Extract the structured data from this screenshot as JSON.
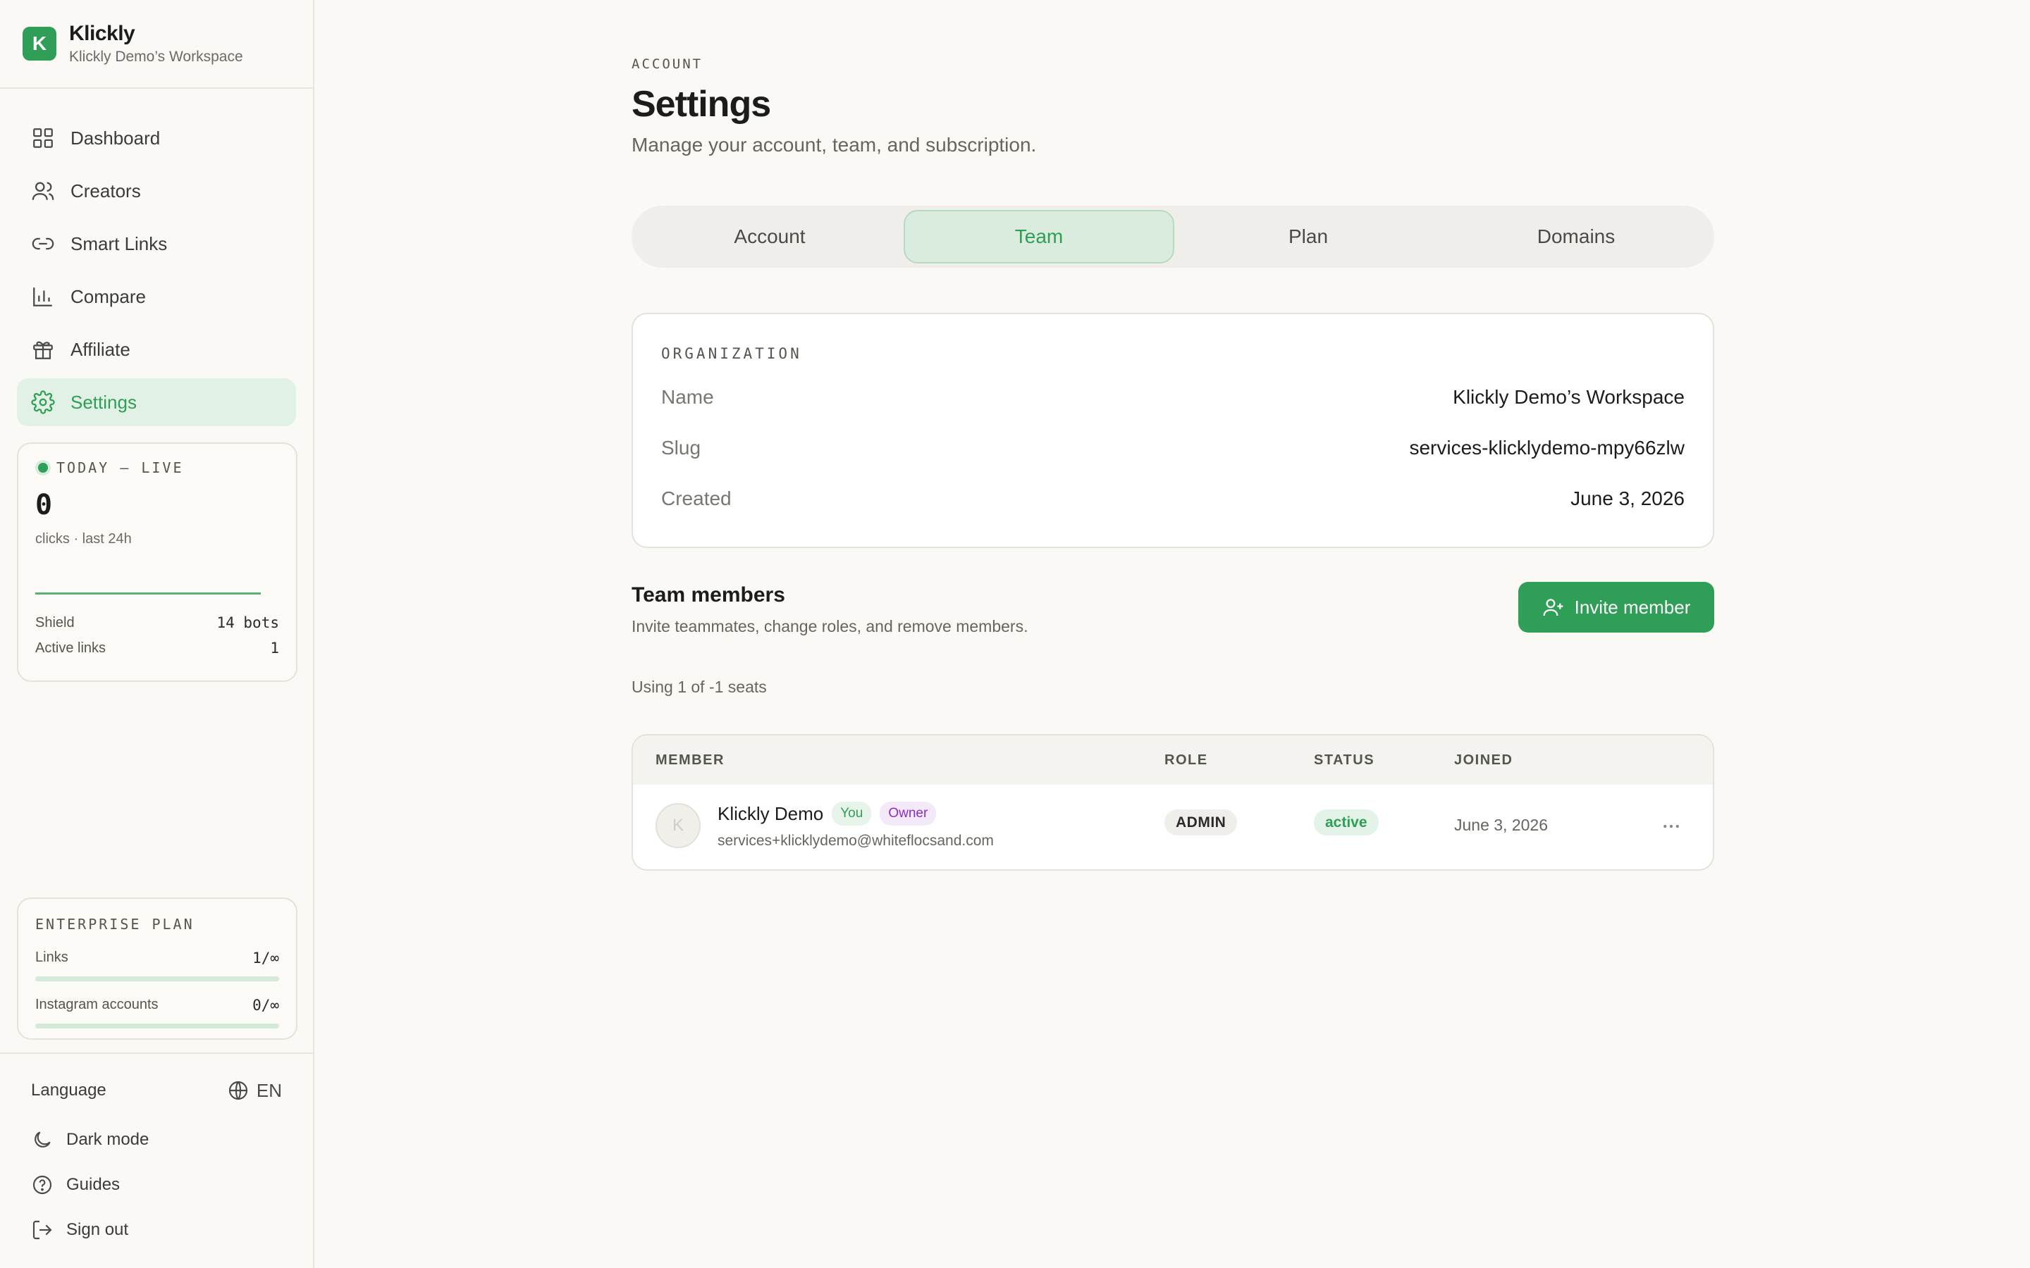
{
  "app": {
    "logo_letter": "K",
    "name": "Klickly",
    "workspace": "Klickly Demo’s Workspace",
    "brand_color": "#2f9e57"
  },
  "sidebar": {
    "items": [
      {
        "label": "Dashboard",
        "icon": "dashboard-grid-icon"
      },
      {
        "label": "Creators",
        "icon": "users-icon"
      },
      {
        "label": "Smart Links",
        "icon": "link-icon"
      },
      {
        "label": "Compare",
        "icon": "bar-chart-icon"
      },
      {
        "label": "Affiliate",
        "icon": "gift-icon"
      },
      {
        "label": "Settings",
        "icon": "gear-icon",
        "active": true
      }
    ],
    "live": {
      "title": "TODAY — LIVE",
      "value": "0",
      "caption": "clicks · last 24h",
      "shield_label": "Shield",
      "shield_value": "14 bots",
      "active_links_label": "Active links",
      "active_links_value": "1"
    },
    "plan": {
      "title": "ENTERPRISE PLAN",
      "links_label": "Links",
      "links_value": "1/∞",
      "links_fill": 0.0,
      "instagram_label": "Instagram accounts",
      "instagram_value": "0/∞",
      "instagram_fill": 0.0
    },
    "language_label": "Language",
    "language_value": "EN",
    "dark_mode_label": "Dark mode",
    "guides_label": "Guides",
    "signout_label": "Sign out"
  },
  "main": {
    "eyebrow": "ACCOUNT",
    "title": "Settings",
    "subtitle": "Manage your account, team, and subscription.",
    "tabs": [
      {
        "label": "Account"
      },
      {
        "label": "Team",
        "active": true
      },
      {
        "label": "Plan"
      },
      {
        "label": "Domains"
      }
    ],
    "organization": {
      "title": "ORGANIZATION",
      "rows": [
        {
          "key": "Name",
          "value": "Klickly Demo’s Workspace"
        },
        {
          "key": "Slug",
          "value": "services-klicklydemo-mpy66zlw"
        },
        {
          "key": "Created",
          "value": "June 3, 2026"
        }
      ]
    },
    "team": {
      "title": "Team members",
      "subtitle": "Invite teammates, change roles, and remove members.",
      "invite_label": "Invite member",
      "seats": "Using 1 of -1 seats",
      "columns": {
        "member": "MEMBER",
        "role": "ROLE",
        "status": "STATUS",
        "joined": "JOINED"
      },
      "members": [
        {
          "avatar_letter": "K",
          "name": "Klickly Demo",
          "you_tag": "You",
          "owner_tag": "Owner",
          "email": "services+klicklydemo@whiteflocsand.com",
          "role": "ADMIN",
          "status": "active",
          "joined": "June 3, 2026"
        }
      ]
    }
  }
}
